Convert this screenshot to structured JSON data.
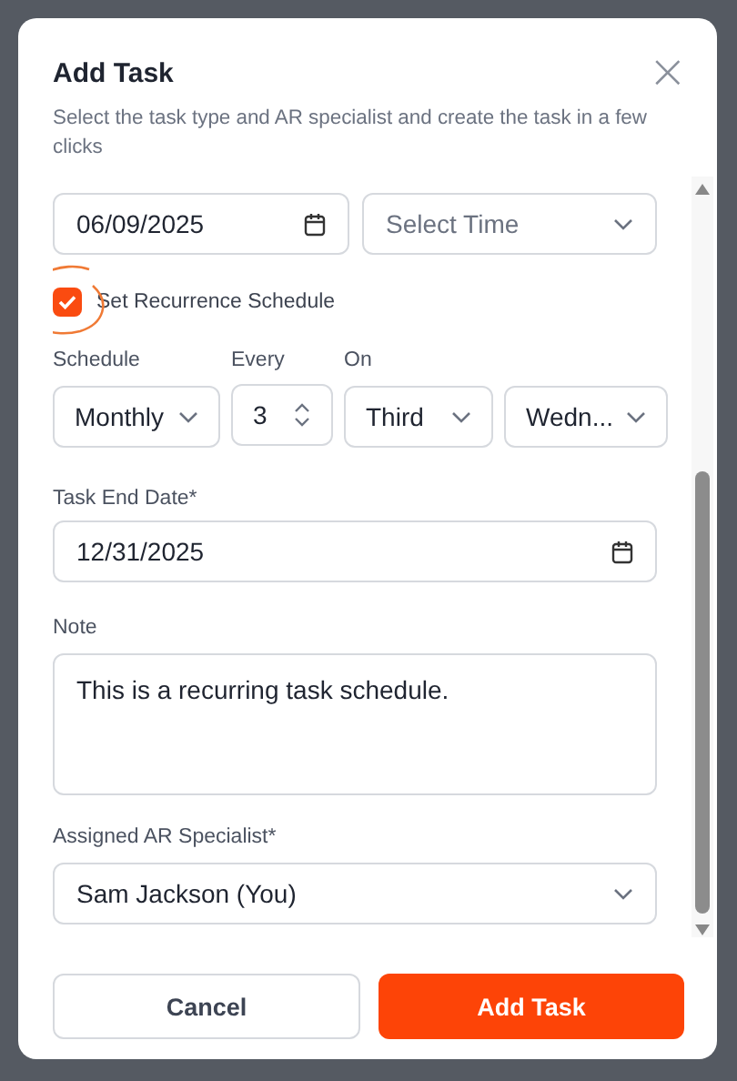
{
  "dialog": {
    "title": "Add Task",
    "subtitle": "Select the task type and AR specialist and create the task in a few clicks",
    "close_icon": "×"
  },
  "task_date": {
    "value": "06/09/2025"
  },
  "task_time": {
    "placeholder": "Select Time"
  },
  "recurrence": {
    "label": "Set Recurrence Schedule",
    "checked": true,
    "annotated": true
  },
  "schedule": [
    {
      "kind": "select",
      "label": "Schedule",
      "value": "Monthly"
    },
    {
      "kind": "stepper",
      "label": "Every",
      "value": "3"
    },
    {
      "kind": "select",
      "label": "On",
      "value": "Third"
    },
    {
      "kind": "select",
      "value": "Wedn..."
    }
  ],
  "end_date": {
    "label": "Task End Date*",
    "value": "12/31/2025"
  },
  "note": {
    "label": "Note",
    "value": "This is a recurring task schedule."
  },
  "specialist": {
    "label": "Assigned AR Specialist*",
    "value": "Sam Jackson (You)"
  },
  "buttons": [
    {
      "kind": "secondary",
      "label": "Cancel"
    },
    {
      "kind": "primary",
      "label": "Add Task"
    }
  ]
}
